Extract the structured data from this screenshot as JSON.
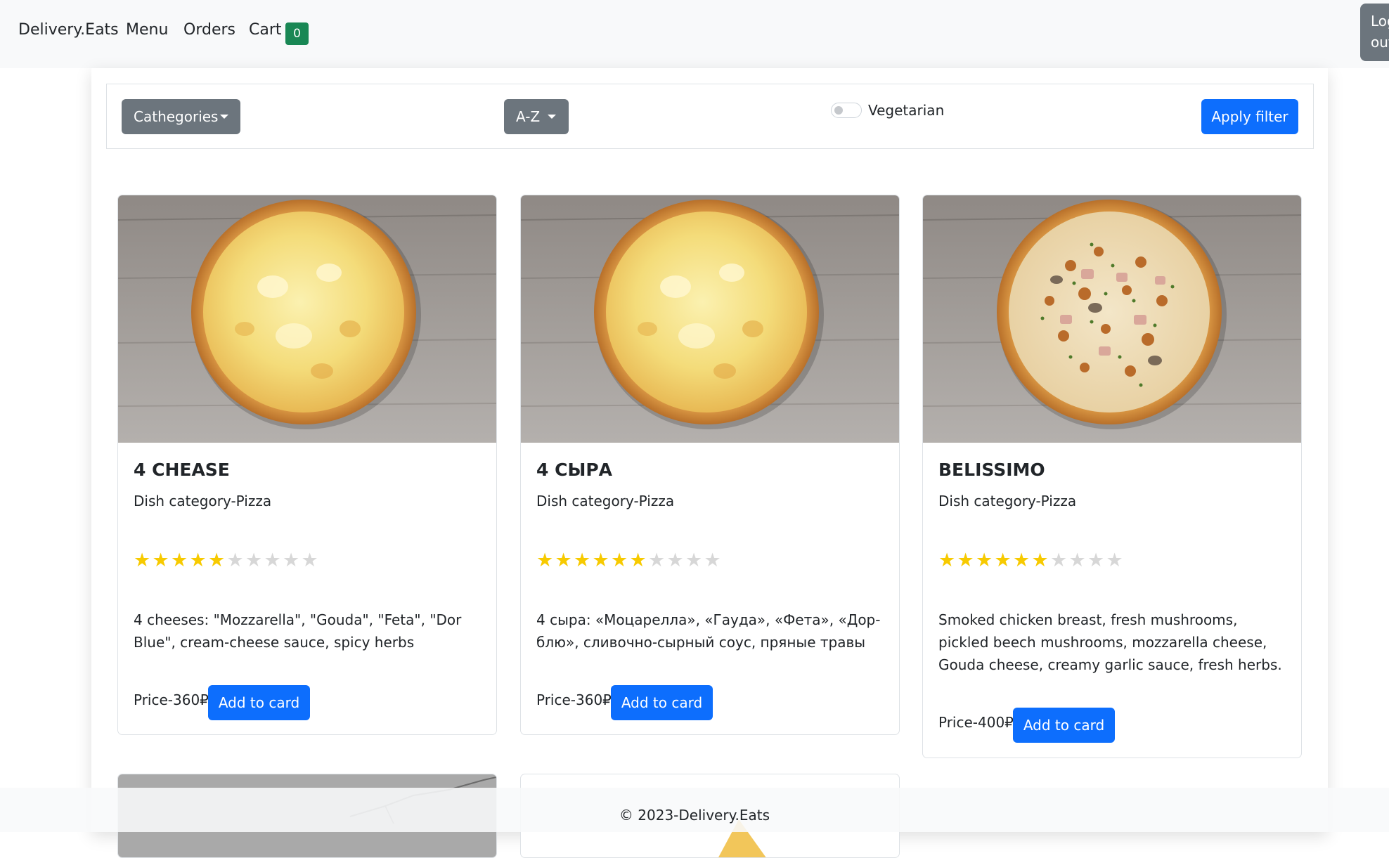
{
  "navbar": {
    "brand": "Delivery.Eats",
    "menu": "Menu",
    "orders": "Orders",
    "cart": "Cart",
    "cart_count": "0",
    "logout": "Log out"
  },
  "filters": {
    "categories": "Cathegories",
    "sort": "A-Z",
    "vegetarian_label": "Vegetarian",
    "vegetarian_checked": false,
    "apply": "Apply filter"
  },
  "dishes": [
    {
      "name": "4 CHEASE",
      "category": "Dish category-Pizza",
      "rating": 5,
      "rating_max": 10,
      "description": "4 cheeses: \"Mozzarella\", \"Gouda\", \"Feta\", \"Dor Blue\", cream-cheese sauce, spicy herbs",
      "price": "Price-360₽",
      "button": "Add to card",
      "image": "cheese-pizza-photo"
    },
    {
      "name": "4 СЫРА",
      "category": "Dish category-Pizza",
      "rating": 6,
      "rating_max": 10,
      "description": "4 сыра: «Моцарелла», «Гауда», «Фета», «Дор-блю», сливочно-сырный соус, пряные травы",
      "price": "Price-360₽",
      "button": "Add to card",
      "image": "cheese-pizza-photo"
    },
    {
      "name": "BELISSIMO",
      "category": "Dish category-Pizza",
      "rating": 6,
      "rating_max": 10,
      "description": "Smoked chicken breast, fresh mushrooms, pickled beech mushrooms, mozzarella cheese, Gouda cheese, creamy garlic sauce, fresh herbs.",
      "price": "Price-400₽",
      "button": "Add to card",
      "image": "mushroom-pizza-photo"
    }
  ],
  "footer": {
    "copyright": "© 2023-Delivery.Eats"
  },
  "colors": {
    "primary": "#0d6efd",
    "secondary": "#6c757d",
    "success": "#198754",
    "star": "#f7ca00",
    "star_off": "#d7d7d7"
  }
}
